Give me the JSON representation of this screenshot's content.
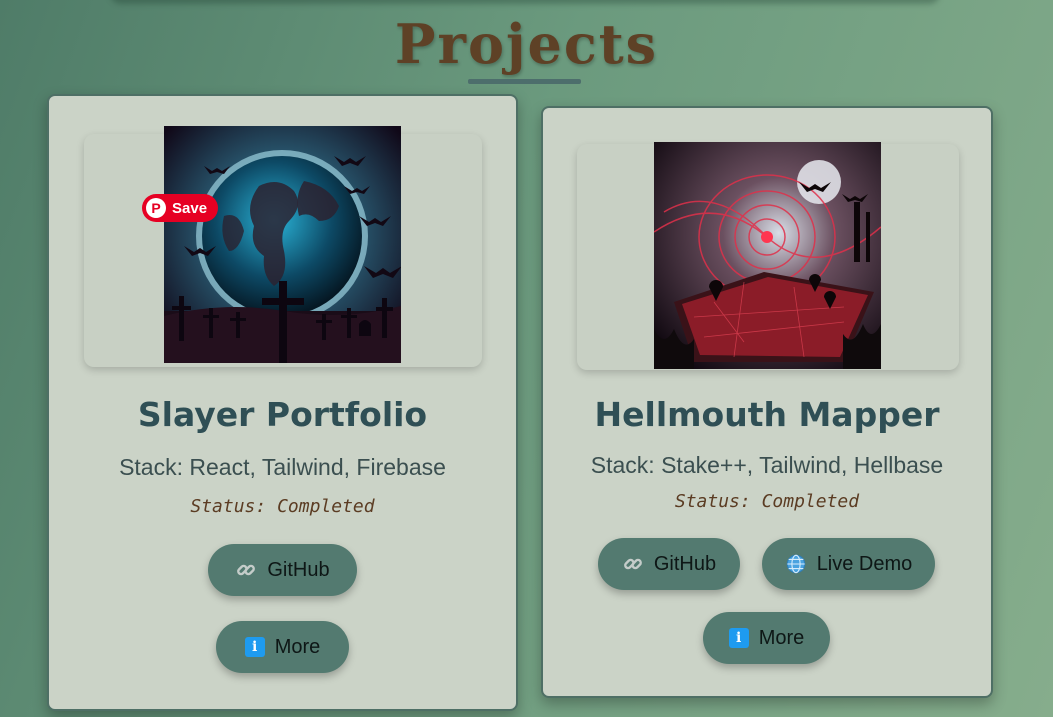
{
  "page": {
    "heading": "Projects"
  },
  "projects": [
    {
      "title": "Slayer Portfolio",
      "stack": "Stack: React, Tailwind, Firebase",
      "status": "Status: Completed",
      "save_label": "Save",
      "buttons": {
        "github": "GitHub",
        "more": "More"
      }
    },
    {
      "title": "Hellmouth Mapper",
      "stack": "Stack: Stake++, Tailwind, Hellbase",
      "status": "Status: Completed",
      "buttons": {
        "github": "GitHub",
        "live_demo": "Live Demo",
        "more": "More"
      }
    }
  ],
  "icons": {
    "github": "link-icon",
    "live_demo": "globe-icon",
    "more": "info-icon",
    "save": "pinterest-icon"
  },
  "colors": {
    "heading": "#5e4126",
    "card_bg": "#cbd3c7",
    "button_bg": "#537a70",
    "pinterest_red": "#e60023",
    "status_text": "#5b3c23"
  }
}
